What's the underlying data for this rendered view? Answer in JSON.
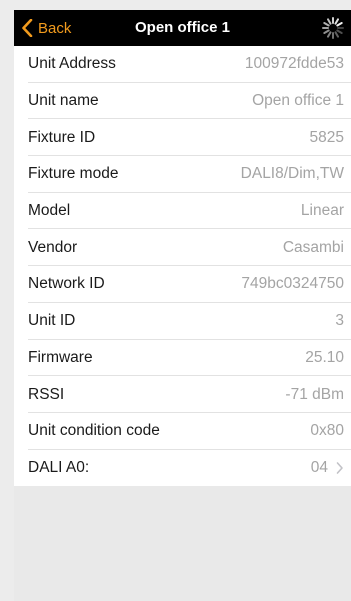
{
  "nav": {
    "back_label": "Back",
    "title": "Open office 1",
    "back_icon": "chevron-left-icon",
    "activity_icon": "activity-spinner-icon",
    "accent_color": "#f29b1d"
  },
  "rows": [
    {
      "label": "Unit Address",
      "value": "100972fdde53"
    },
    {
      "label": "Unit name",
      "value": "Open office 1"
    },
    {
      "label": "Fixture ID",
      "value": "5825"
    },
    {
      "label": "Fixture mode",
      "value": "DALI8/Dim,TW"
    },
    {
      "label": "Model",
      "value": "Linear"
    },
    {
      "label": "Vendor",
      "value": "Casambi"
    },
    {
      "label": "Network ID",
      "value": "749bc0324750"
    },
    {
      "label": "Unit ID",
      "value": "3"
    },
    {
      "label": "Firmware",
      "value": "25.10"
    },
    {
      "label": "RSSI",
      "value": "-71 dBm"
    },
    {
      "label": "Unit condition code",
      "value": "0x80"
    },
    {
      "label": "DALI A0:",
      "value": "04"
    }
  ]
}
